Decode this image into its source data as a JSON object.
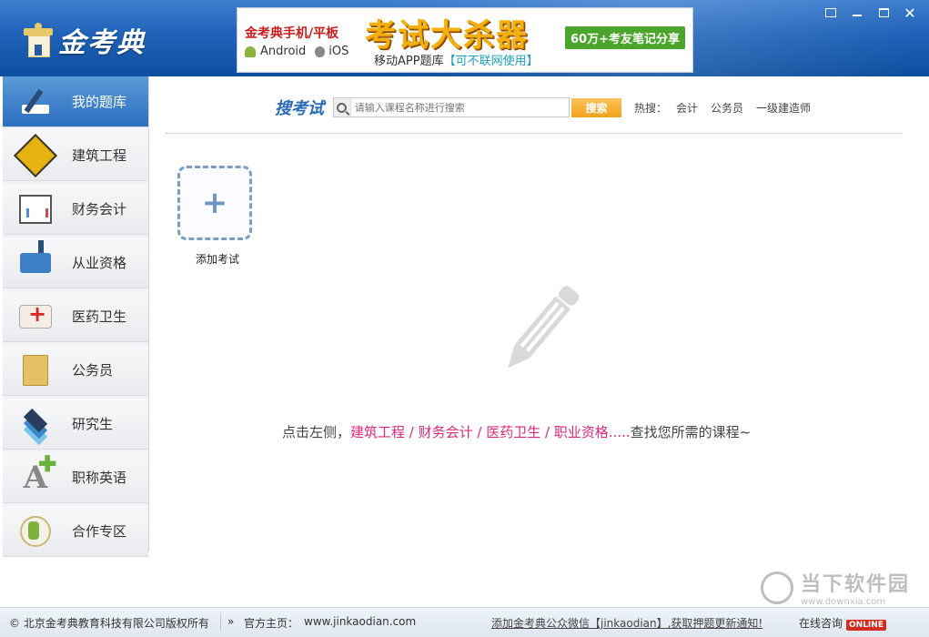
{
  "app": {
    "logo_text": "金考典"
  },
  "banner": {
    "line1": "金考典手机/平板",
    "android": "Android",
    "ios": "iOS",
    "headline": "考试大杀器",
    "sub_prefix": "移动APP题库",
    "sub_highlight": "【可不联网使用】",
    "badge": "60万+考友笔记分享"
  },
  "sidebar": {
    "items": [
      {
        "label": "我的题库",
        "icon": "pencil-book-icon"
      },
      {
        "label": "建筑工程",
        "icon": "construction-sign-icon"
      },
      {
        "label": "财务会计",
        "icon": "chart-board-icon"
      },
      {
        "label": "从业资格",
        "icon": "books-icon"
      },
      {
        "label": "医药卫生",
        "icon": "medical-kit-icon"
      },
      {
        "label": "公务员",
        "icon": "folder-icon"
      },
      {
        "label": "研究生",
        "icon": "layers-icon"
      },
      {
        "label": "职称英语",
        "icon": "letter-a-icon"
      },
      {
        "label": "合作专区",
        "icon": "cooperation-icon"
      }
    ]
  },
  "search": {
    "title": "搜考试",
    "placeholder": "请输入课程名称进行搜索",
    "button": "搜索",
    "hot_label": "热搜：",
    "hot_items": [
      "会计",
      "公务员",
      "一级建造师"
    ]
  },
  "main": {
    "add_label": "添加考试",
    "hint_prefix": "点击左侧，",
    "hint_links": "建筑工程 / 财务会计 / 医药卫生 / 职业资格.....",
    "hint_suffix": "查找您所需的课程~"
  },
  "footer": {
    "copyright": "© 北京金考典教育科技有限公司版权所有",
    "homepage_label": "官方主页：",
    "homepage_url": "www.jinkaodian.com",
    "wechat_notice": "添加金考典公众微信【jinkaodian】,获取押题更新通知!",
    "online_consult": "在线咨询",
    "online_badge": "ONLINE"
  },
  "watermark": {
    "title": "当下软件园",
    "url": "www.downxia.com"
  }
}
